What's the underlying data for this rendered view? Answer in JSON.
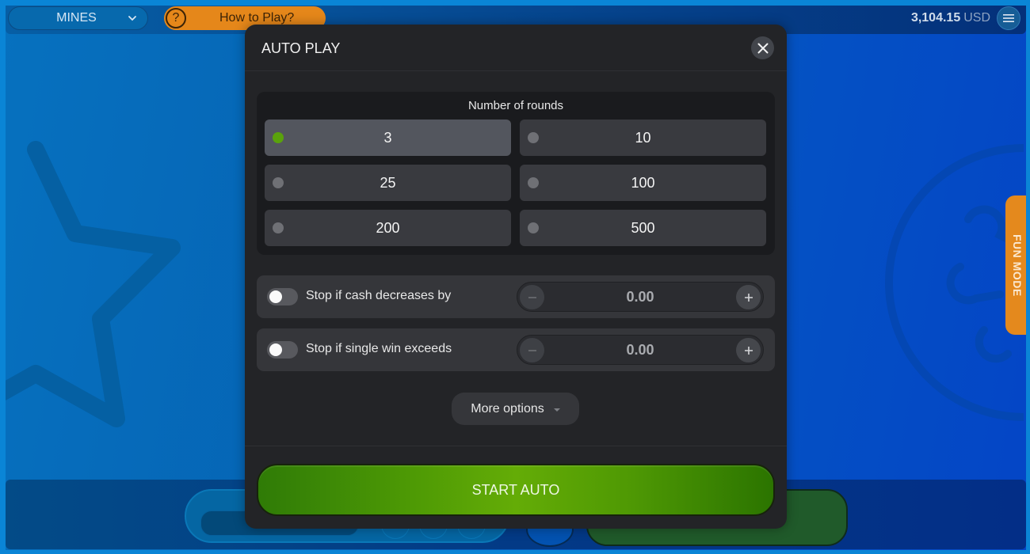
{
  "topbar": {
    "game_select": {
      "label": "MINES",
      "icon": "chevron-down-icon"
    },
    "how_to_play": {
      "label": "How to Play?",
      "icon": "question-circle-icon"
    },
    "balance": {
      "amount": "3,104.15",
      "currency": "USD"
    },
    "menu_icon": "hamburger-menu-icon"
  },
  "side_tab": {
    "label": "FUN MODE"
  },
  "modal": {
    "title": "AUTO PLAY",
    "close_icon": "close-icon",
    "rounds": {
      "title": "Number of rounds",
      "selected": "3",
      "options": [
        {
          "label": "3",
          "selected": true
        },
        {
          "label": "10",
          "selected": false
        },
        {
          "label": "25",
          "selected": false
        },
        {
          "label": "100",
          "selected": false
        },
        {
          "label": "200",
          "selected": false
        },
        {
          "label": "500",
          "selected": false
        }
      ]
    },
    "stop_rules": [
      {
        "label": "Stop if cash decreases by",
        "enabled": false,
        "value": "0.00"
      },
      {
        "label": "Stop if single win exceeds",
        "enabled": false,
        "value": "0.00"
      }
    ],
    "more_options_label": "More options",
    "start_label": "START AUTO"
  },
  "colors": {
    "accent_green": "#5aa20c",
    "start_button": "#4e9a05",
    "how_to_play_orange": "#e5871a",
    "fun_mode_orange": "#e4891d",
    "modal_bg": "#232427"
  }
}
